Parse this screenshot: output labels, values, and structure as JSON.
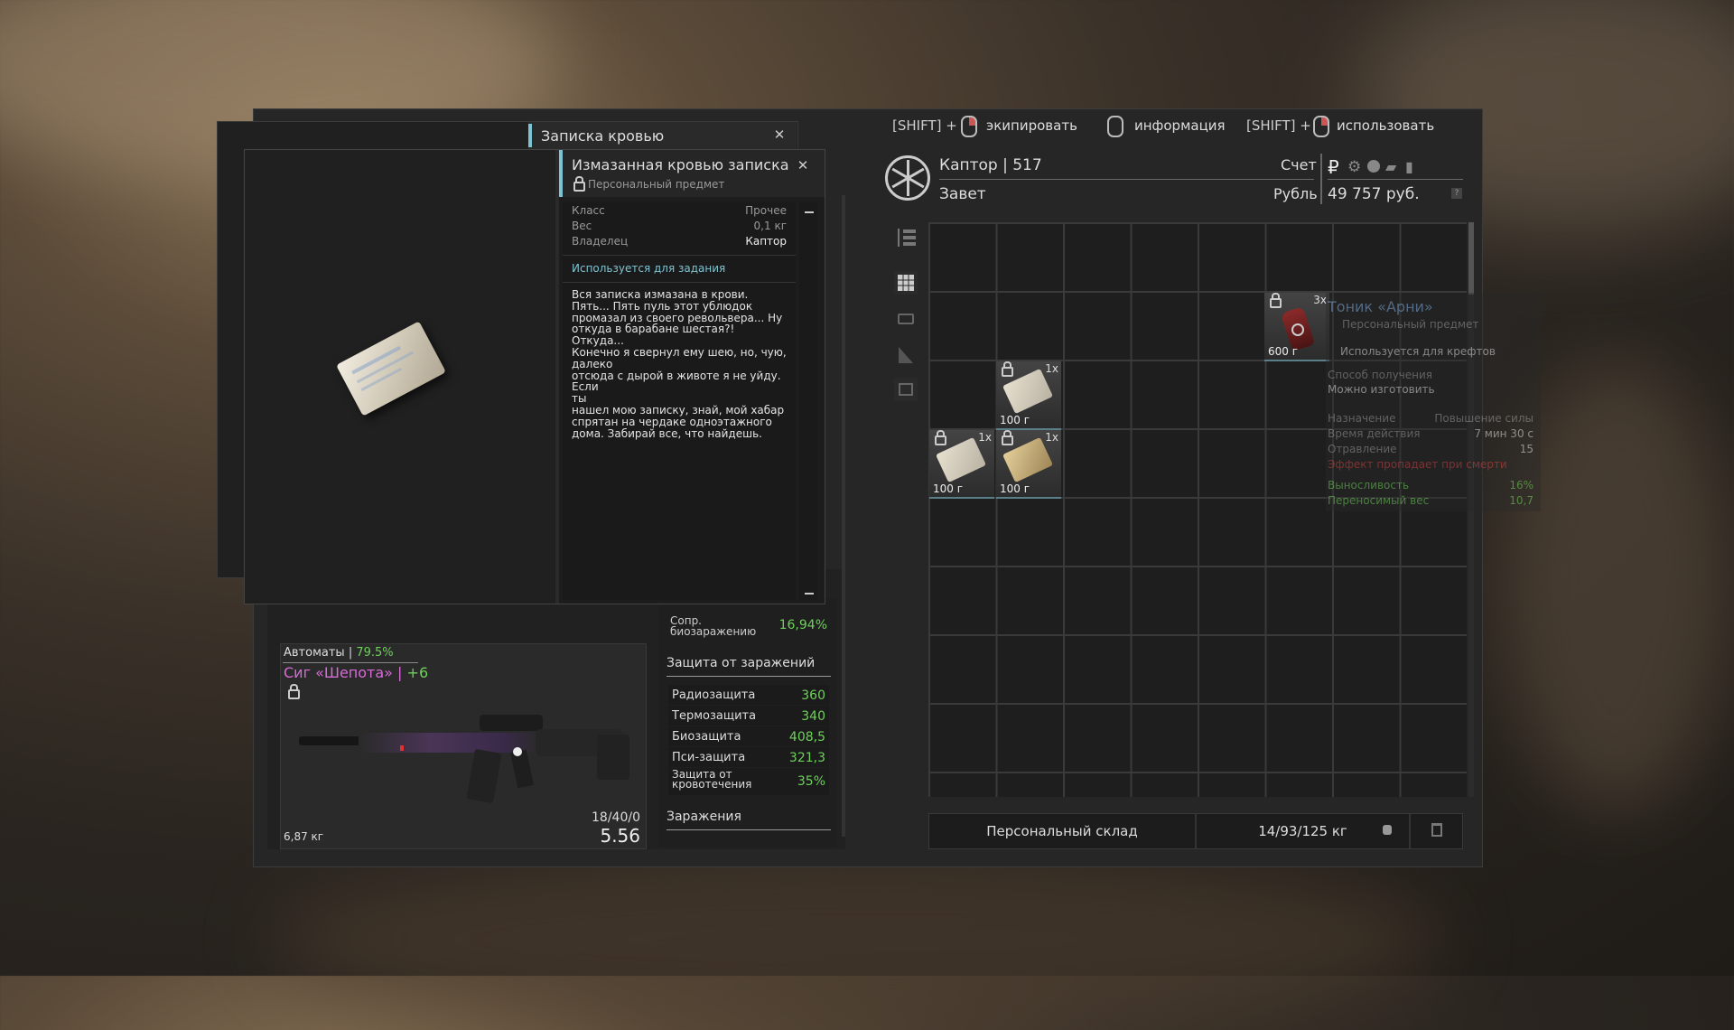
{
  "hints": [
    {
      "prefix": "[SHIFT] +",
      "label": "экипировать"
    },
    {
      "prefix": "",
      "label": "информация"
    },
    {
      "prefix": "[SHIFT] +",
      "label": "использовать"
    }
  ],
  "note_window": {
    "title": "Записка кровью"
  },
  "item_window": {
    "title": "Измазанная кровью записка",
    "subtitle": "Персональный предмет",
    "props": [
      {
        "k": "Класс",
        "v": "Прочее"
      },
      {
        "k": "Вес",
        "v": "0,1 кг"
      },
      {
        "k": "Владелец",
        "v": "Каптор"
      }
    ],
    "quest_label": "Используется для задания",
    "text": "Вся записка измазана в крови.\nПять... Пять пуль этот ублюдок\nпромазал из своего револьвера... Ну\nоткуда в барабане шестая?! Откуда...\nКонечно я свернул ему шею, но, чую,\nдалеко\nотсюда с дырой в животе я не уйду. Если\nты\nнашел мою записку, знай, мой хабар\nспрятан на чердаке одноэтажного\nдома. Забирай все, что найдешь."
  },
  "weapon": {
    "category": "Автоматы | ",
    "category_pct": "79.5%",
    "name": "Сиг «Шепота» | ",
    "upgrade": "+6",
    "weight": "6,87 кг",
    "ammo": "18/40/0",
    "caliber": "5.56"
  },
  "stats": {
    "bio_label": "Сопр.\nбиозаражению",
    "bio_value": "16,94%",
    "protection_title": "Защита от заражений",
    "rows": [
      {
        "k": "Радиозащита",
        "v": "360"
      },
      {
        "k": "Термозащита",
        "v": "340"
      },
      {
        "k": "Биозащита",
        "v": "408,5"
      },
      {
        "k": "Пси-защита",
        "v": "321,3"
      },
      {
        "k": "Защита от\nкровотечения",
        "v": "35%"
      }
    ],
    "infections_title": "Заражения"
  },
  "player": {
    "name": "Каптор | 517",
    "faction": "Завет",
    "account_label": "Счет",
    "currency_label": "Рубль",
    "balance": "49 757 руб."
  },
  "grid_items": [
    {
      "qty": "3x",
      "weight": "600 г",
      "kind": "tonic"
    },
    {
      "qty": "1x",
      "weight": "100 г",
      "kind": "note"
    },
    {
      "qty": "1x",
      "weight": "100 г",
      "kind": "note"
    },
    {
      "qty": "1x",
      "weight": "100 г",
      "kind": "note2"
    }
  ],
  "tooltip": {
    "title": "Тоник «Арни»",
    "subtitle": "Персональный предмет",
    "craft": "Используется для крефтов",
    "source_label": "Способ получения",
    "source_value": "Можно изготовить",
    "purpose_label": "Назначение",
    "purpose_value": "Повышение силы",
    "duration_label": "Время действия",
    "duration_value": "7 мин 30 с",
    "poison_label": "Отравление",
    "poison_value": "15",
    "death_note": "Эффект пропадает при смерти",
    "stamina_label": "Выносливость",
    "stamina_value": "16%",
    "carry_label": "Переносимый вес",
    "carry_value": "10,7"
  },
  "storage": {
    "label": "Персональный склад",
    "capacity": "14/93/125 кг"
  },
  "colors": {
    "accent": "#7ec3d1",
    "green": "#6fd05b",
    "pink": "#d86bd8",
    "link": "#7da7d9",
    "red": "#c44"
  }
}
